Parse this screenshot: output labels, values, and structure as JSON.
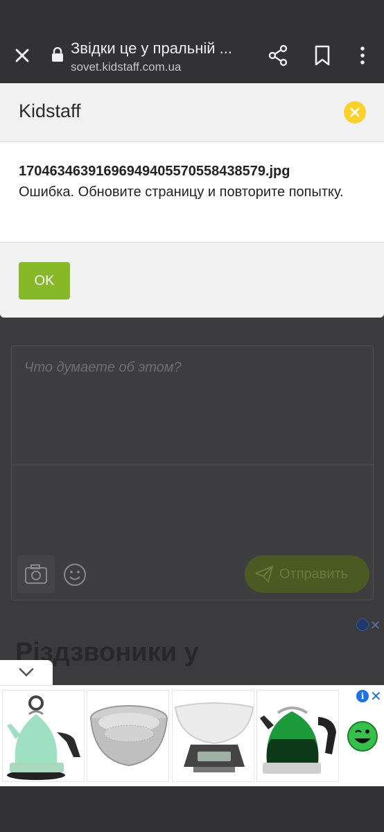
{
  "browser": {
    "page_title": "Звідки це у пральній ...",
    "url": "sovet.kidstaff.com.ua"
  },
  "dialog": {
    "site_name": "Kidstaff",
    "file_name": "17046346391696949405570558438579.jpg",
    "message": "Ошибка. Обновите страницу и повторите попытку.",
    "ok_label": "OK"
  },
  "comment": {
    "placeholder": "Что думаете об этом?",
    "send_label": "Отправить"
  },
  "ad": {
    "heading": "Різдзвоники у",
    "info_glyph": "i",
    "close_glyph": "✕",
    "products": [
      "teal-kettle",
      "strainer-basket",
      "kitchen-scale",
      "green-kettle"
    ]
  },
  "colors": {
    "accent_green": "#86b827",
    "close_yellow": "#fbd12a",
    "ad_blue": "#1a73e8"
  }
}
